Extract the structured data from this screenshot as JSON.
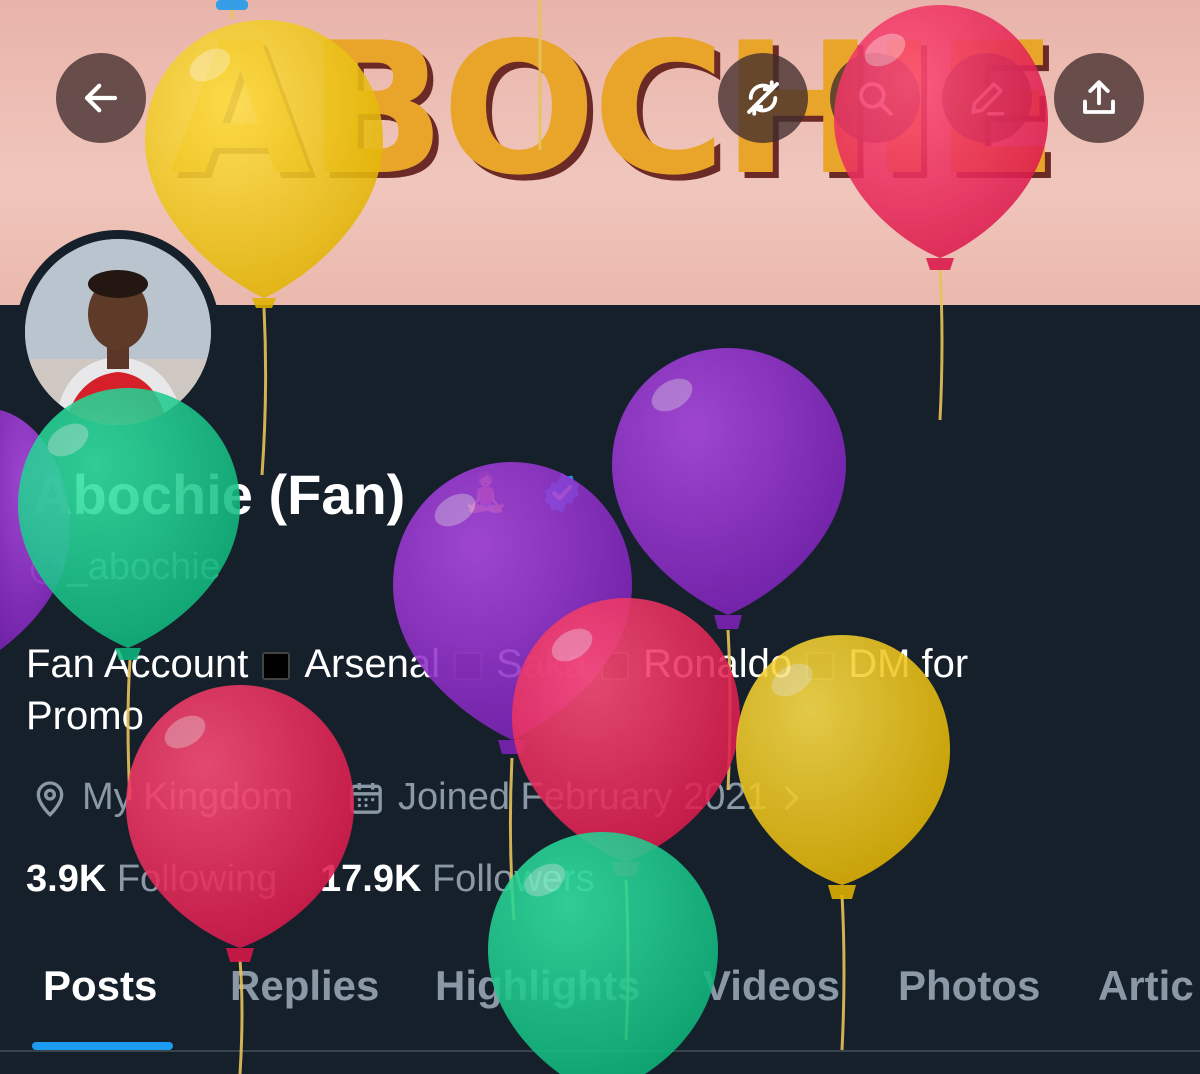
{
  "banner": {
    "text": "ABOCHIE"
  },
  "toolbar": {
    "back_icon": "arrow-left-icon",
    "refresh_icon": "refresh-slash-icon",
    "search_icon": "search-icon",
    "edit_icon": "pencil-icon",
    "share_icon": "share-upload-icon"
  },
  "profile": {
    "name": "Abochie (Fan)",
    "handle": "@_abochie",
    "bio": {
      "parts": [
        "Fan Account",
        "Arsenal",
        "Saka",
        "Ronaldo",
        "DM for"
      ],
      "line2": "Promo"
    },
    "location": "My Kingdom",
    "joined": "Joined February 2021",
    "following_count": "3.9K",
    "following_label": "Following",
    "followers_count": "17.9K",
    "followers_label": "Followers"
  },
  "tabs": [
    "Posts",
    "Replies",
    "Highlights",
    "Videos",
    "Photos",
    "Artic"
  ],
  "colors": {
    "background": "#15202b",
    "accent": "#1d9bf0",
    "verified": "#1d9bf0",
    "muted_text": "#8b98a5"
  }
}
